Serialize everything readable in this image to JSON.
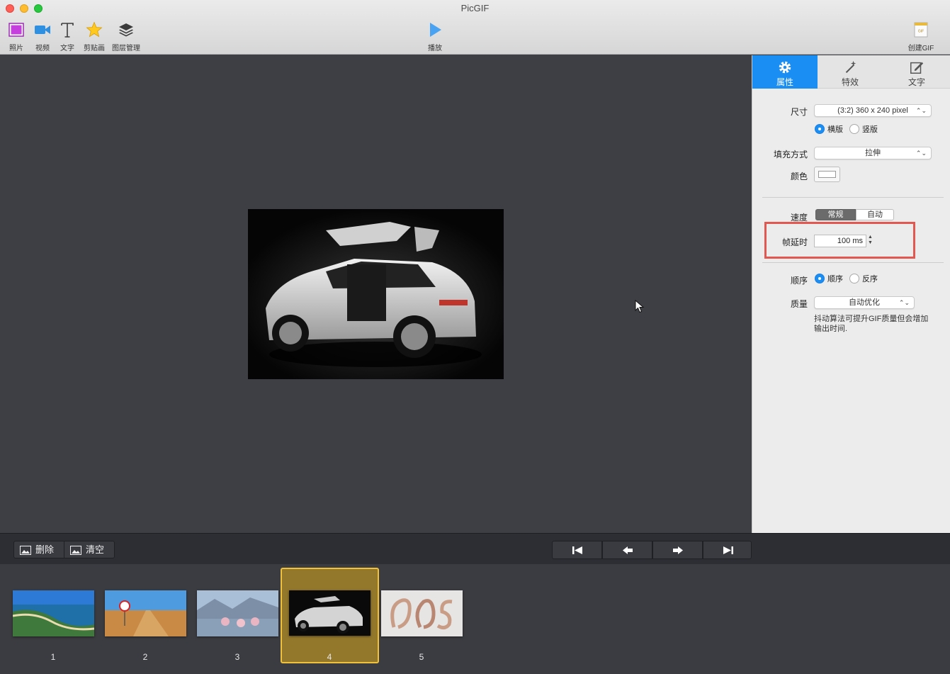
{
  "window": {
    "title": "PicGIF"
  },
  "toolbar": {
    "photo": "照片",
    "video": "视频",
    "text": "文字",
    "clipart": "剪贴画",
    "layers": "图层管理",
    "play": "播放",
    "create_gif": "创建GIF",
    "gif_icon_text": "GIF"
  },
  "panel": {
    "tabs": [
      {
        "label": "属性",
        "icon": "gear-icon",
        "active": true
      },
      {
        "label": "特效",
        "icon": "magic-wand-icon",
        "active": false
      },
      {
        "label": "文字",
        "icon": "edit-icon",
        "active": false
      }
    ],
    "size": {
      "label": "尺寸",
      "value": "(3:2) 360 x 240 pixel"
    },
    "orientation": {
      "landscape": "横版",
      "portrait": "竖版",
      "selected": "横版"
    },
    "fill": {
      "label": "填充方式",
      "value": "拉伸"
    },
    "color": {
      "label": "颜色",
      "value": "#ffffff"
    },
    "speed": {
      "label": "速度",
      "normal": "常规",
      "auto": "自动",
      "selected": "常规"
    },
    "frame_delay": {
      "label": "帧延时",
      "value": "100 ms"
    },
    "order": {
      "label": "顺序",
      "forward": "顺序",
      "reverse": "反序",
      "selected": "顺序"
    },
    "quality": {
      "label": "质量",
      "value": "自动优化",
      "hint_line1": "抖动算法可提升GIF质量但会增加",
      "hint_line2": "输出时间."
    }
  },
  "frame_controls": {
    "delete": "删除",
    "clear": "清空"
  },
  "frames": [
    {
      "number": "1",
      "selected": false
    },
    {
      "number": "2",
      "selected": false
    },
    {
      "number": "3",
      "selected": false
    },
    {
      "number": "4",
      "selected": true
    },
    {
      "number": "5",
      "selected": false
    }
  ],
  "colors": {
    "accent": "#1b8ef4",
    "highlight": "#e2574f",
    "selected_frame": "#f0c13a"
  }
}
